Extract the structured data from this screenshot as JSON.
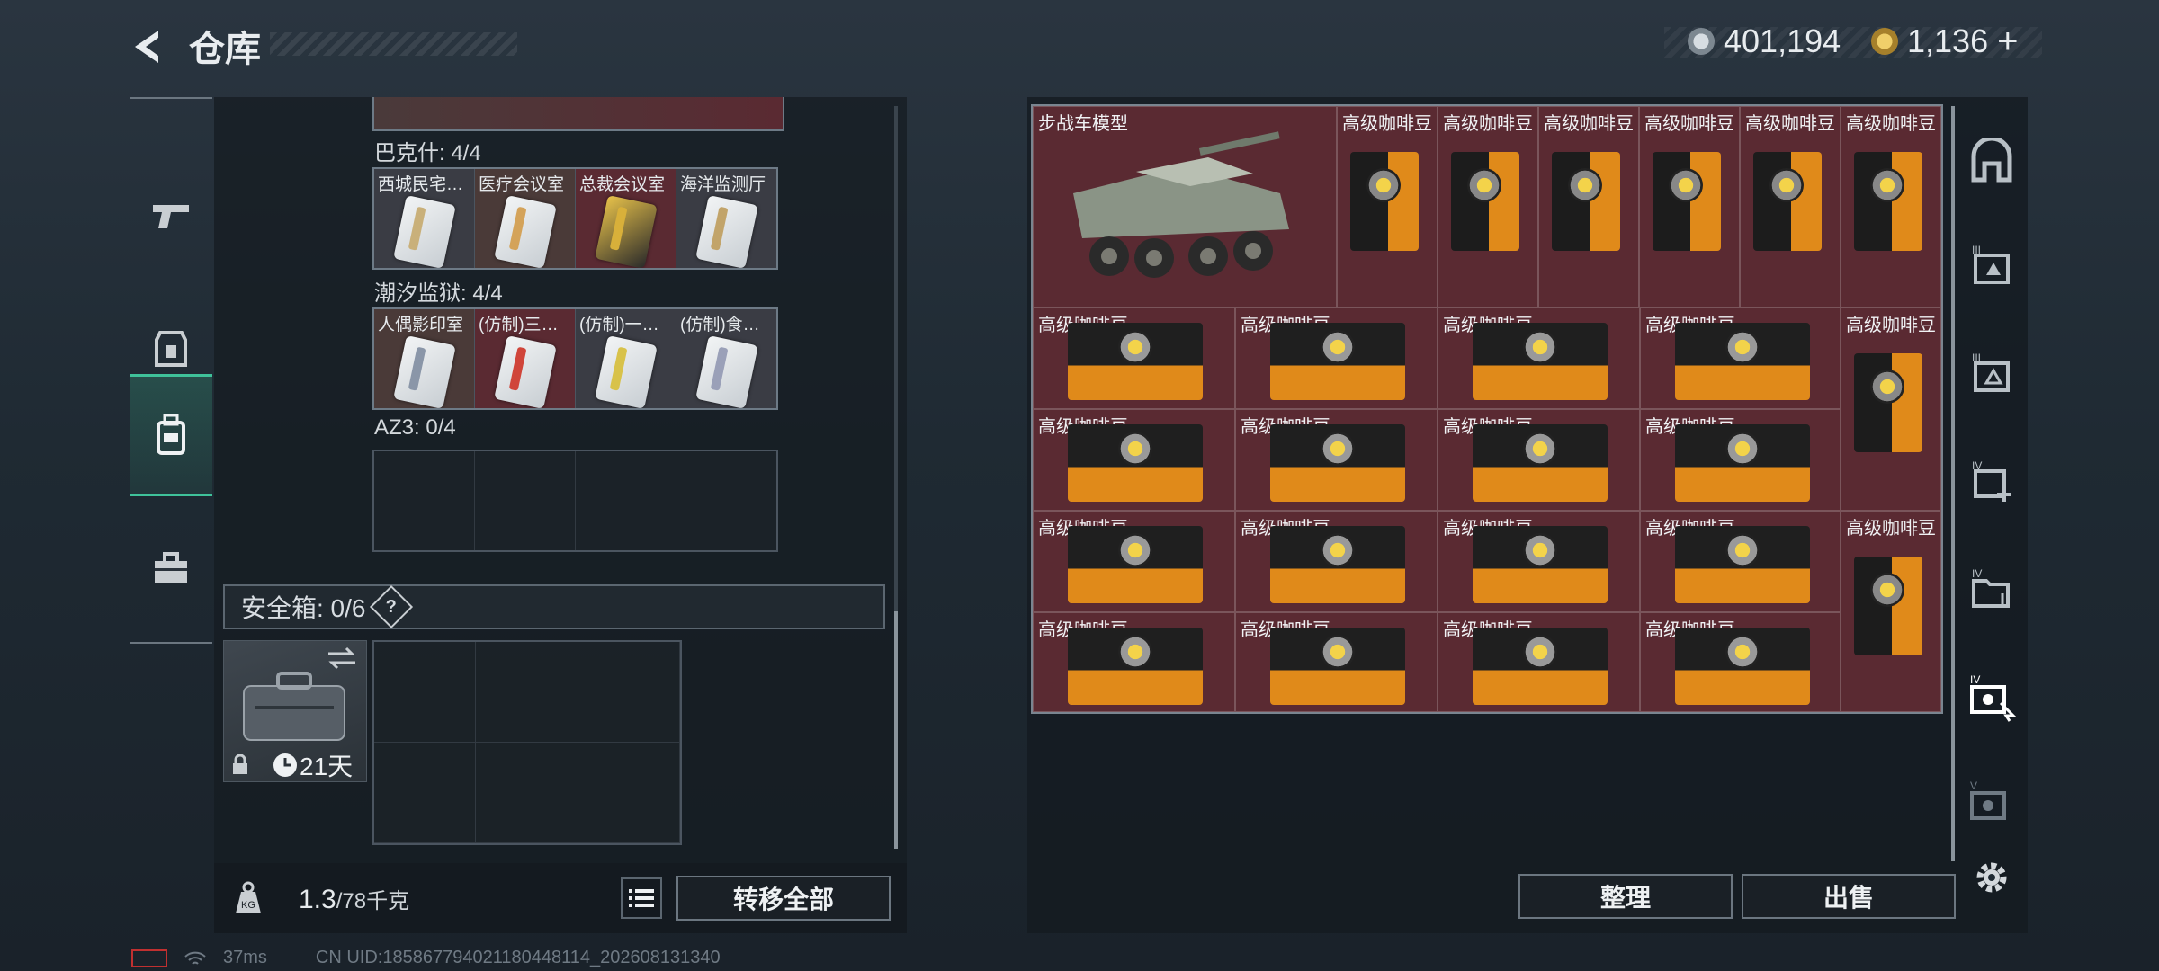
{
  "header": {
    "title": "仓库",
    "currency_a": "401,194",
    "currency_b": "1,136",
    "add_symbol": "+"
  },
  "left_nav": [
    "gun-icon",
    "armor-icon",
    "backpack-icon",
    "briefcase-icon"
  ],
  "left_panel": {
    "sections": [
      {
        "label": "巴克什: 4/4",
        "cards": [
          {
            "label": "西城民宅…",
            "stripe": "#c9b07a"
          },
          {
            "label": "医疗会议室",
            "stripe": "#d4a35a"
          },
          {
            "label": "总裁会议室",
            "stripe": "#d8b03a"
          },
          {
            "label": "海洋监测厅",
            "stripe": "#c2a46a"
          }
        ]
      },
      {
        "label": "潮汐监狱: 4/4",
        "cards": [
          {
            "label": "人偶影印室",
            "stripe": "#8a96a8"
          },
          {
            "label": "(仿制)三…",
            "stripe": "#d0453a"
          },
          {
            "label": "(仿制)一…",
            "stripe": "#d8c24a"
          },
          {
            "label": "(仿制)食…",
            "stripe": "#9aa0b8"
          }
        ]
      },
      {
        "label": "AZ3: 0/4",
        "cards": []
      }
    ],
    "safe_box_label": "安全箱: 0/6",
    "help": "?",
    "safe_days": "21天",
    "weight_current": "1.3",
    "weight_max": "/78千克",
    "transfer_all": "转移全部"
  },
  "right_panel": {
    "vehicle_label": "步战车模型",
    "coffee_label": "高级咖啡豆",
    "sort_button": "整理",
    "sell_button": "出售"
  },
  "status_bar": {
    "ping": "37ms",
    "uid": "CN UID:185867794021180448114_202608131340"
  }
}
